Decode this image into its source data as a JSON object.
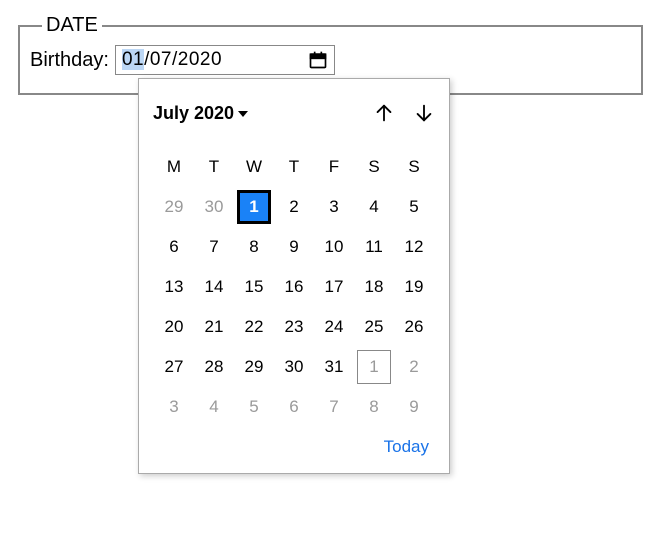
{
  "fieldset": {
    "legend": "DATE",
    "label": "Birthday:"
  },
  "date_input": {
    "day": "01",
    "sep1": "/",
    "month": "07",
    "sep2": "/",
    "year": "2020"
  },
  "calendar": {
    "month_label": "July 2020",
    "dow": [
      "M",
      "T",
      "W",
      "T",
      "F",
      "S",
      "S"
    ],
    "today_label": "Today",
    "rows": [
      [
        {
          "n": "29",
          "o": true
        },
        {
          "n": "30",
          "o": true
        },
        {
          "n": "1",
          "sel": true
        },
        {
          "n": "2"
        },
        {
          "n": "3"
        },
        {
          "n": "4"
        },
        {
          "n": "5"
        }
      ],
      [
        {
          "n": "6"
        },
        {
          "n": "7"
        },
        {
          "n": "8"
        },
        {
          "n": "9"
        },
        {
          "n": "10"
        },
        {
          "n": "11"
        },
        {
          "n": "12"
        }
      ],
      [
        {
          "n": "13"
        },
        {
          "n": "14"
        },
        {
          "n": "15"
        },
        {
          "n": "16"
        },
        {
          "n": "17"
        },
        {
          "n": "18"
        },
        {
          "n": "19"
        }
      ],
      [
        {
          "n": "20"
        },
        {
          "n": "21"
        },
        {
          "n": "22"
        },
        {
          "n": "23"
        },
        {
          "n": "24"
        },
        {
          "n": "25"
        },
        {
          "n": "26"
        }
      ],
      [
        {
          "n": "27"
        },
        {
          "n": "28"
        },
        {
          "n": "29"
        },
        {
          "n": "30"
        },
        {
          "n": "31"
        },
        {
          "n": "1",
          "o": true,
          "out": true
        },
        {
          "n": "2",
          "o": true
        }
      ],
      [
        {
          "n": "3",
          "o": true
        },
        {
          "n": "4",
          "o": true
        },
        {
          "n": "5",
          "o": true
        },
        {
          "n": "6",
          "o": true
        },
        {
          "n": "7",
          "o": true
        },
        {
          "n": "8",
          "o": true
        },
        {
          "n": "9",
          "o": true
        }
      ]
    ]
  }
}
